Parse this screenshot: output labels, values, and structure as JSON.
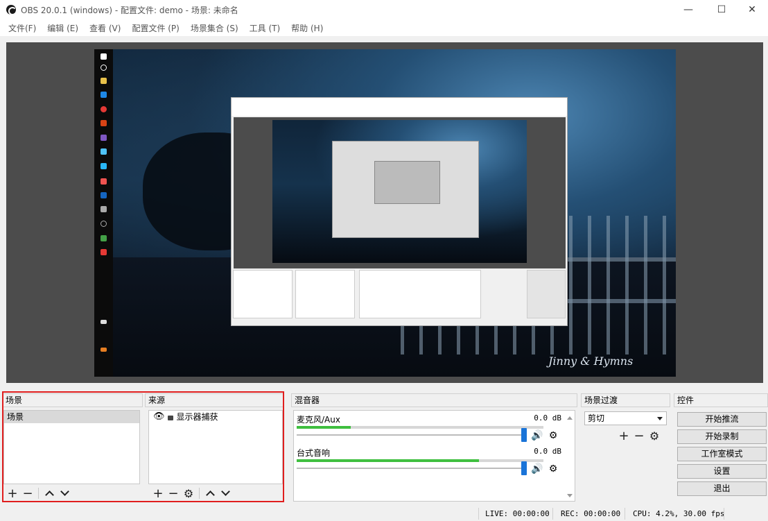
{
  "window": {
    "title": "OBS 20.0.1 (windows) - 配置文件: demo - 场景: 未命名",
    "minimize": "—",
    "maximize": "☐",
    "close": "✕"
  },
  "menu": [
    "文件(F)",
    "编辑 (E)",
    "查看 (V)",
    "配置文件 (P)",
    "场景集合 (S)",
    "工具 (T)",
    "帮助 (H)"
  ],
  "scenes": {
    "header": "场景",
    "items": [
      "场景"
    ],
    "selected_index": 0
  },
  "sources": {
    "header": "来源",
    "items": [
      {
        "name": "显示器捕获",
        "visible_icon": "eye-icon",
        "lock_icon": "lock-icon"
      }
    ]
  },
  "mixer": {
    "header": "混音器",
    "tracks": [
      {
        "name": "麦克风/Aux",
        "db": "0.0 dB",
        "level": 0.22
      },
      {
        "name": "台式音响",
        "db": "0.0 dB",
        "level": 0.74
      }
    ]
  },
  "transitions": {
    "header": "场景过渡",
    "selected": "剪切"
  },
  "controls": {
    "header": "控件",
    "buttons": [
      "开始推流",
      "开始录制",
      "工作室模式",
      "设置",
      "退出"
    ]
  },
  "status": {
    "live": "LIVE: 00:00:00",
    "rec": "REC: 00:00:00",
    "cpu": "CPU: 4.2%, 30.00 fps"
  },
  "preview": {
    "signature": "Jinny & Hymns"
  },
  "colors": {
    "highlight_frame": "#e01e1e",
    "meter_green": "#3fbf3f",
    "slider_blue": "#1a74d8"
  }
}
